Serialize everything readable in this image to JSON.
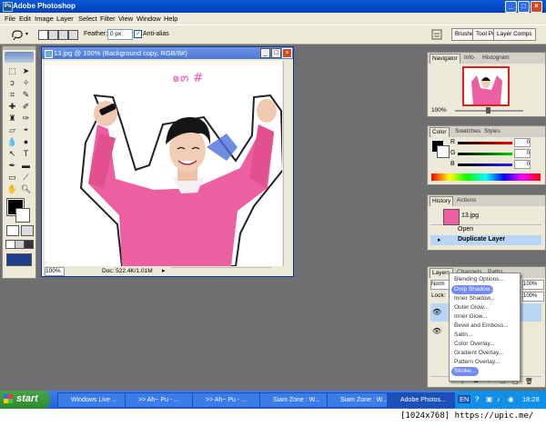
{
  "app": {
    "title": "Adobe Photoshop",
    "logo_text": "Ps"
  },
  "window_controls": {
    "minimize": "_",
    "maximize": "□",
    "close": "×"
  },
  "menu": [
    "File",
    "Edit",
    "Image",
    "Layer",
    "Select",
    "Filter",
    "View",
    "Window",
    "Help"
  ],
  "options_bar": {
    "feather_label": "Feather:",
    "feather_value": "0 px",
    "antialias_label": "Anti-alias",
    "antialias_checked": true,
    "palette_well": [
      "Brushes",
      "Tool Pr",
      "Layer Comps"
    ]
  },
  "document": {
    "title": "13.jpg @ 100% (Background copy, RGB/8#)",
    "zoom": "100%",
    "doc_size": "Doc: 522.4K/1.01M",
    "canvas_text": "๑๓ #"
  },
  "navigator": {
    "tabs": [
      "Navigator",
      "Info",
      "Histogram"
    ],
    "zoom": "100%"
  },
  "color": {
    "tabs": [
      "Color",
      "Swatches",
      "Styles"
    ],
    "channels": [
      {
        "label": "R",
        "value": "0",
        "accent": "#e02020"
      },
      {
        "label": "G",
        "value": "0",
        "accent": "#20a020"
      },
      {
        "label": "B",
        "value": "0",
        "accent": "#2040e0"
      }
    ]
  },
  "history": {
    "tabs": [
      "History",
      "Actions"
    ],
    "snapshot": "13.jpg",
    "items": [
      "Open",
      "Duplicate Layer"
    ]
  },
  "layers": {
    "tabs": [
      "Layers",
      "Channels",
      "Paths"
    ],
    "blend_mode": "Norm",
    "opacity": "100%",
    "lock_label": "Lock:",
    "fill": "100%"
  },
  "layer_style_menu": {
    "items": [
      "Blending Options...",
      "Drop Shadow...",
      "Inner Shadow...",
      "Outer Glow...",
      "Inner Glow...",
      "Bevel and Emboss...",
      "Satin...",
      "Color Overlay...",
      "Gradient Overlay...",
      "Pattern Overlay...",
      "Stroke..."
    ],
    "highlighted": [
      "Drop Shadow...",
      "Stroke..."
    ]
  },
  "taskbar": {
    "start": "start",
    "tasks": [
      "Windows Live ...",
      ">> Ah~ Pu - ...",
      ">> Ah~ Pu - ...",
      "Siam Zone : W...",
      "Siam Zone : W...",
      "Adobe Photos..."
    ],
    "active_task": "Adobe Photos...",
    "language": "EN",
    "clock": "18:28"
  },
  "watermark": "[1024x768] https://upic.me/"
}
